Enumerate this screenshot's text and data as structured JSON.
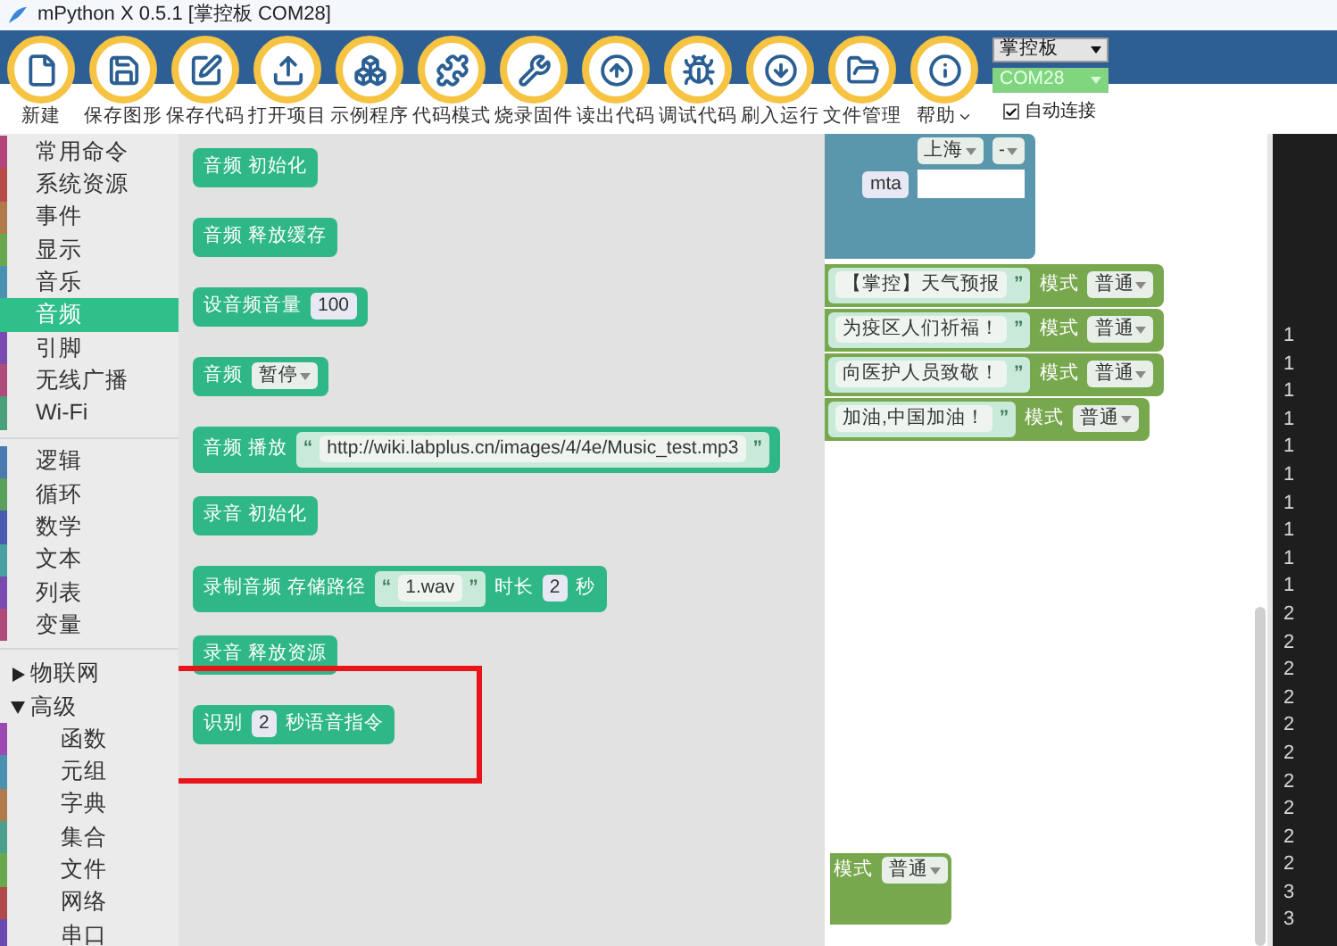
{
  "window": {
    "title": "mPython X 0.5.1 [掌控板 COM28]"
  },
  "toolbar": {
    "buttons": [
      {
        "kind": "new",
        "label": "新建"
      },
      {
        "kind": "save",
        "label": "保存图形"
      },
      {
        "kind": "edit",
        "label": "保存代码"
      },
      {
        "kind": "upload",
        "label": "打开项目"
      },
      {
        "kind": "boxes",
        "label": "示例程序"
      },
      {
        "kind": "puzzle",
        "label": "代码模式"
      },
      {
        "kind": "wrench",
        "label": "烧录固件"
      },
      {
        "kind": "up",
        "label": "读出代码"
      },
      {
        "kind": "bug",
        "label": "调试代码"
      },
      {
        "kind": "down",
        "label": "刷入运行"
      },
      {
        "kind": "folder",
        "label": "文件管理"
      },
      {
        "kind": "info",
        "label": "帮助",
        "menu": true
      }
    ],
    "board_select": {
      "value": "掌控板"
    },
    "port_select": {
      "value": "COM28"
    },
    "auto_connect": {
      "label": "自动连接",
      "checked": true
    }
  },
  "sidebar": {
    "groups": [
      {
        "items": [
          {
            "kind": "category",
            "label": "常用命令",
            "color": "#b4457c",
            "selected": false
          },
          {
            "kind": "category",
            "label": "系统资源",
            "color": "#b84a4a",
            "selected": false
          },
          {
            "kind": "category",
            "label": "事件",
            "color": "#b07a4a",
            "selected": false
          },
          {
            "kind": "category",
            "label": "显示",
            "color": "#6aa84f",
            "selected": false
          },
          {
            "kind": "category",
            "label": "音乐",
            "color": "#4a90b0",
            "selected": false
          },
          {
            "kind": "category",
            "label": "音频",
            "color": "#2ebf8a",
            "selected": true
          },
          {
            "kind": "category",
            "label": "引脚",
            "color": "#7a4ab0",
            "selected": false
          },
          {
            "kind": "category",
            "label": "无线广播",
            "color": "#b04a7a",
            "selected": false
          },
          {
            "kind": "category",
            "label": "Wi-Fi",
            "color": "#4aa07a",
            "selected": false
          }
        ]
      },
      {
        "items": [
          {
            "kind": "category",
            "label": "逻辑",
            "color": "#4a7ab0",
            "selected": false
          },
          {
            "kind": "category",
            "label": "循环",
            "color": "#5aa05a",
            "selected": false
          },
          {
            "kind": "category",
            "label": "数学",
            "color": "#4a5ab0",
            "selected": false
          },
          {
            "kind": "category",
            "label": "文本",
            "color": "#4aa0a0",
            "selected": false
          },
          {
            "kind": "category",
            "label": "列表",
            "color": "#7a4ab0",
            "selected": false
          },
          {
            "kind": "category",
            "label": "变量",
            "color": "#b04a7a",
            "selected": false
          }
        ]
      },
      {
        "items": [
          {
            "kind": "folder",
            "label": "物联网",
            "expanded": false
          },
          {
            "kind": "folder",
            "label": "高级",
            "expanded": true,
            "children": [
              {
                "kind": "category",
                "label": "函数",
                "color": "#9a4ab0",
                "selected": false
              },
              {
                "kind": "category",
                "label": "元组",
                "color": "#4a90b0",
                "selected": false
              },
              {
                "kind": "category",
                "label": "字典",
                "color": "#b07a4a",
                "selected": false
              },
              {
                "kind": "category",
                "label": "集合",
                "color": "#4aa08a",
                "selected": false
              },
              {
                "kind": "category",
                "label": "文件",
                "color": "#6aa84f",
                "selected": false
              },
              {
                "kind": "category",
                "label": "网络",
                "color": "#b04a4a",
                "selected": false
              },
              {
                "kind": "category",
                "label": "串口",
                "color": "#6a4ab0",
                "selected": false
              }
            ]
          }
        ]
      }
    ]
  },
  "flyout": {
    "blocks": [
      {
        "parts": [
          {
            "kind": "label",
            "text": "音频 初始化"
          }
        ]
      },
      {
        "parts": [
          {
            "kind": "label",
            "text": "音频 释放缓存"
          }
        ]
      },
      {
        "parts": [
          {
            "kind": "label",
            "text": "设音频音量"
          },
          {
            "kind": "number",
            "text": "100"
          }
        ]
      },
      {
        "parts": [
          {
            "kind": "label",
            "text": "音频"
          },
          {
            "kind": "dropdown",
            "text": "暂停"
          }
        ]
      },
      {
        "parts": [
          {
            "kind": "label",
            "text": "音频 播放"
          },
          {
            "kind": "string",
            "open": "“",
            "text": "http://wiki.labplus.cn/images/4/4e/Music_test.mp3",
            "close": "”"
          }
        ]
      },
      {
        "parts": [
          {
            "kind": "label",
            "text": "录音 初始化"
          }
        ]
      },
      {
        "parts": [
          {
            "kind": "label",
            "text": "录制音频 存储路径"
          },
          {
            "kind": "string",
            "open": "“",
            "text": "1.wav",
            "close": "”"
          },
          {
            "kind": "label",
            "text": "时长"
          },
          {
            "kind": "number",
            "text": "2"
          },
          {
            "kind": "label",
            "text": "秒"
          }
        ]
      },
      {
        "parts": [
          {
            "kind": "label",
            "text": "录音 释放资源"
          }
        ]
      },
      {
        "parts": [
          {
            "kind": "label",
            "text": "识别"
          },
          {
            "kind": "number",
            "text": "2"
          },
          {
            "kind": "label",
            "text": "秒语音指令"
          }
        ],
        "highlighted": true
      }
    ]
  },
  "workspace": {
    "blocks": [
      {
        "color": "#5a97ad",
        "rows": [
          [
            {
              "kind": "dropdown",
              "text": "上海"
            },
            {
              "kind": "dropdown",
              "text": "-"
            }
          ],
          [
            {
              "kind": "number",
              "text": "mta"
            },
            {
              "kind": "blank"
            }
          ]
        ]
      },
      {
        "color": "#78a84e",
        "rows": [
          [
            {
              "kind": "string",
              "text": "【掌控】天气预报",
              "close": "”"
            },
            {
              "kind": "label",
              "text": "模式"
            },
            {
              "kind": "dropdown",
              "text": "普通"
            }
          ]
        ]
      },
      {
        "color": "#78a84e",
        "rows": [
          [
            {
              "kind": "string",
              "text": "为疫区人们祈福！",
              "close": "”"
            },
            {
              "kind": "label",
              "text": "模式"
            },
            {
              "kind": "dropdown",
              "text": "普通"
            }
          ]
        ]
      },
      {
        "color": "#78a84e",
        "rows": [
          [
            {
              "kind": "string",
              "text": "向医护人员致敬！",
              "close": "”"
            },
            {
              "kind": "label",
              "text": "模式"
            },
            {
              "kind": "dropdown",
              "text": "普通"
            }
          ]
        ]
      },
      {
        "color": "#78a84e",
        "rows": [
          [
            {
              "kind": "string",
              "text": "加油,中国加油！",
              "close": "”"
            },
            {
              "kind": "label",
              "text": "模式"
            },
            {
              "kind": "dropdown",
              "text": "普通"
            }
          ]
        ]
      },
      {
        "color": "#78a84e",
        "rows": [
          [
            {
              "kind": "label",
              "text": "模式"
            },
            {
              "kind": "dropdown",
              "text": "普通"
            }
          ]
        ]
      }
    ]
  },
  "code_panel": {
    "line_numbers": [
      "1",
      "1",
      "1",
      "1",
      "1",
      "1",
      "1",
      "1",
      "1",
      "1",
      "2",
      "2",
      "2",
      "2",
      "2",
      "2",
      "2",
      "2",
      "2",
      "2",
      "3",
      "3"
    ]
  }
}
